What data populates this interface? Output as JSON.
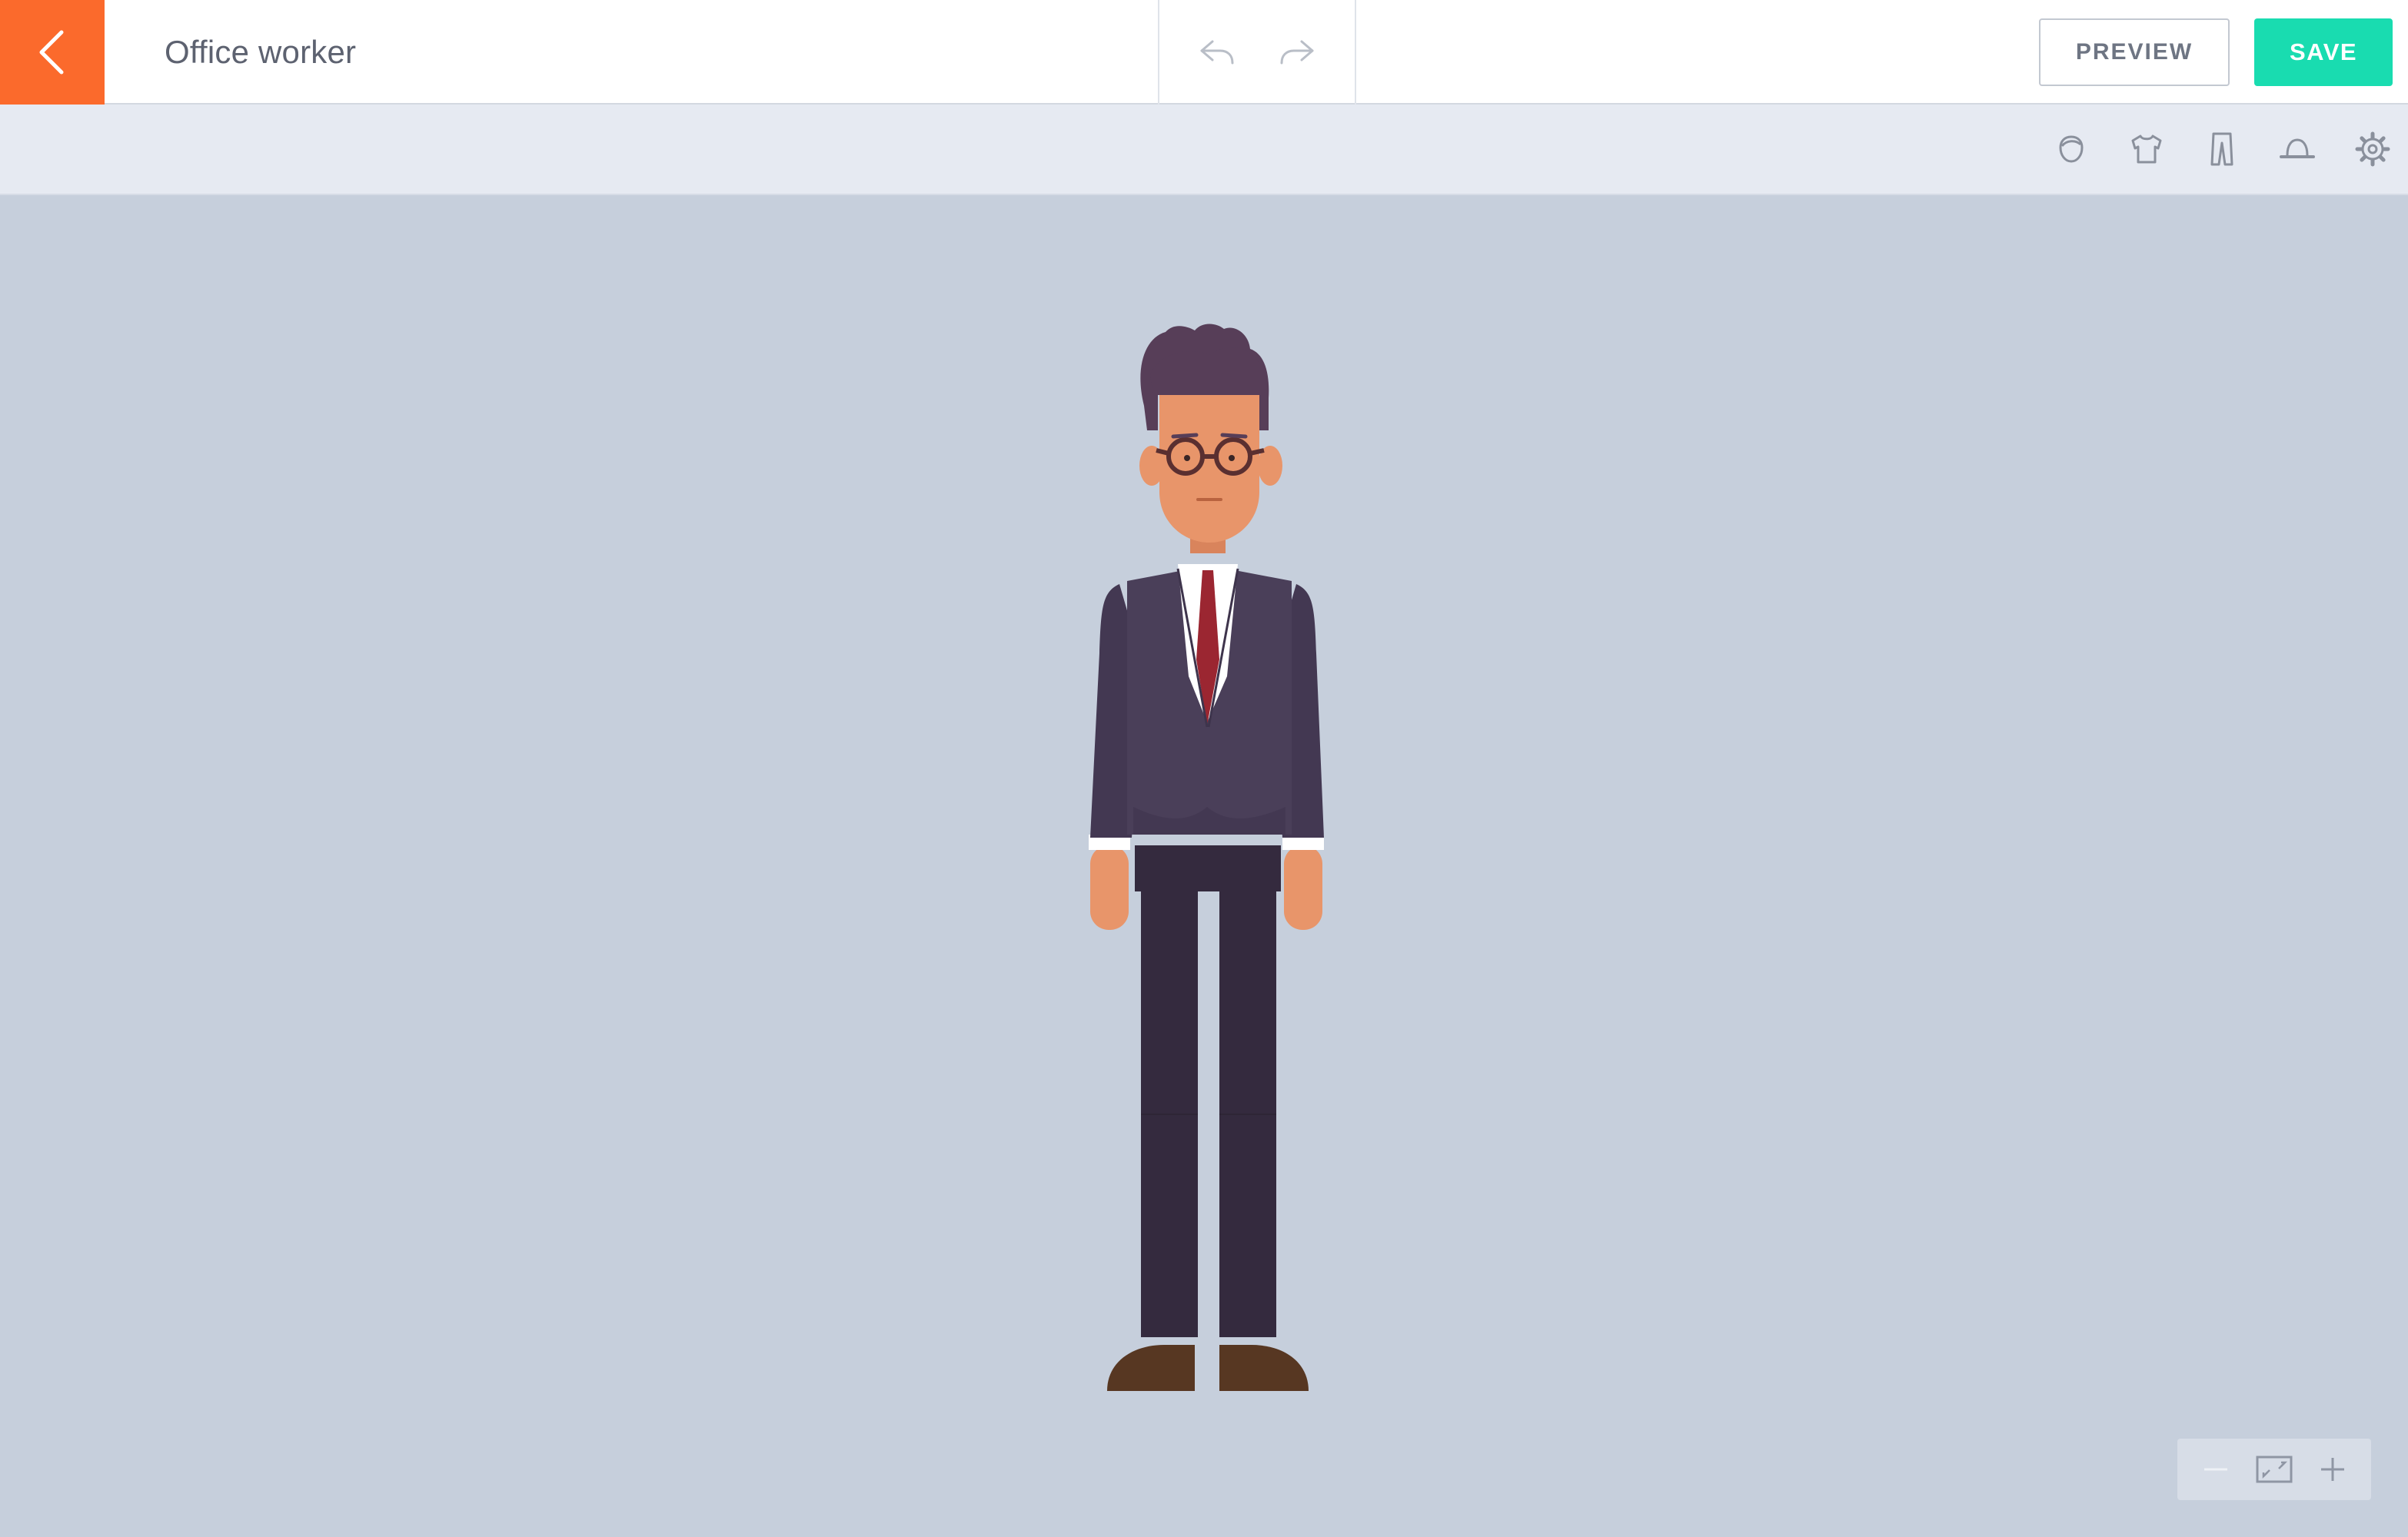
{
  "header": {
    "title": "Office worker",
    "preview_label": "PREVIEW",
    "save_label": "SAVE",
    "back_icon": "chevron-left-icon",
    "undo_icon": "undo-icon",
    "redo_icon": "redo-icon"
  },
  "toolbar": {
    "icons": [
      "head-icon",
      "shirt-icon",
      "pants-icon",
      "hat-icon",
      "gear-icon"
    ]
  },
  "zoom": {
    "icons": [
      "zoom-out-icon",
      "fit-screen-icon",
      "zoom-in-icon"
    ]
  },
  "colors": {
    "accent_back": "#fb6a2c",
    "save_button": "#19dcb0",
    "canvas_bg": "#c6cfdc",
    "toolbar_bg": "#e6eaf2",
    "skin": "#e8956a",
    "hair": "#573e58",
    "suit_jacket": "#4a3f59",
    "suit_pants": "#342a3e",
    "tie": "#9b2631",
    "shoes": "#573722"
  }
}
